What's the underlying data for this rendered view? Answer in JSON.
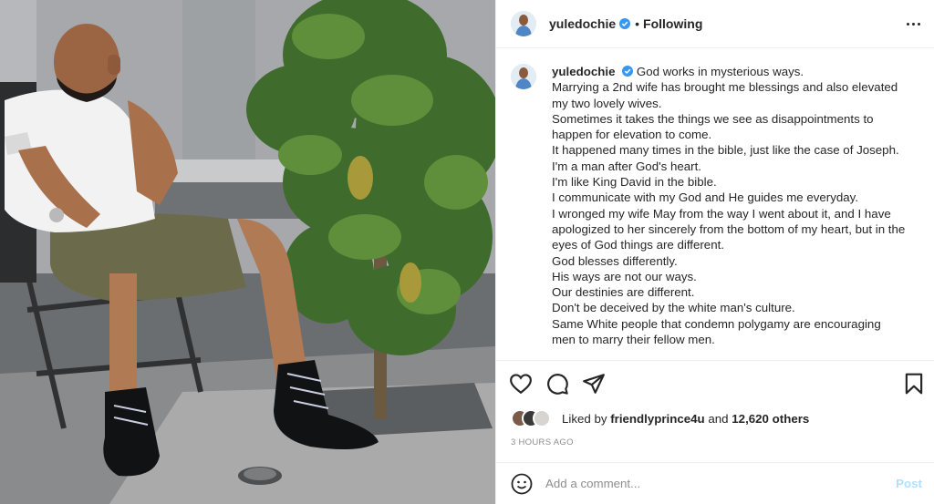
{
  "post": {
    "username": "yuledochie",
    "follow_status": "Following",
    "separator": "•"
  },
  "caption": {
    "username": "yuledochie",
    "lines": [
      "God works in mysterious ways.",
      "Marrying a 2nd wife has brought me blessings and also elevated my two lovely wives.",
      "Sometimes it takes the things we see as disappointments to happen for elevation to come.",
      "It happened many times in the bible, just like the case of Joseph.",
      "I'm a man after God's heart.",
      "I'm like King David in the bible.",
      "I communicate with my God and He guides me everyday.",
      "I wronged my wife May from the way I went about it, and I have apologized to her sincerely from the bottom of my heart, but in the eyes of God things are different.",
      "God blesses differently.",
      "His ways are not our ways.",
      "Our destinies are different.",
      "Don't be deceived by the white man's culture.",
      "Same White people that condemn polygamy are encouraging men to marry their fellow men."
    ]
  },
  "likes": {
    "prefix": "Liked by",
    "user": "friendlyprince4u",
    "connector": "and",
    "others": "12,620 others"
  },
  "timestamp": "3 HOURS AGO",
  "comment": {
    "placeholder": "Add a comment...",
    "post_label": "Post"
  },
  "icons": {
    "verified": "verified-badge-icon",
    "more": "more-options-icon",
    "like": "heart-icon",
    "comment": "comment-icon",
    "share": "share-icon",
    "save": "bookmark-icon",
    "emoji": "emoji-icon"
  },
  "colors": {
    "text": "#262626",
    "muted": "#8e8e8e",
    "verified_blue": "#3897f0",
    "post_disabled": "#b2dffc",
    "divider": "#efefef"
  }
}
